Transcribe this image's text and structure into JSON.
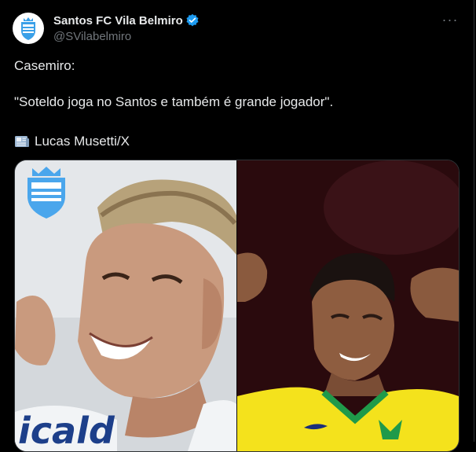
{
  "tweet": {
    "display_name": "Santos FC Vila Belmiro",
    "handle": "@SVilabelmiro",
    "more_label": "···",
    "lines": [
      "Casemiro:",
      "\"Soteldo joga no Santos e também é grande jogador\".",
      "Lucas Musetti/X"
    ]
  },
  "icons": {
    "verified": "verified-badge-icon",
    "newspaper": "newspaper-icon",
    "more": "more-dots-icon",
    "logo": "santos-crest-logo"
  },
  "colors": {
    "background": "#000000",
    "text": "#e7e9ea",
    "secondary": "#71767b",
    "verified": "#1d9bf0",
    "border": "#2f3336"
  }
}
